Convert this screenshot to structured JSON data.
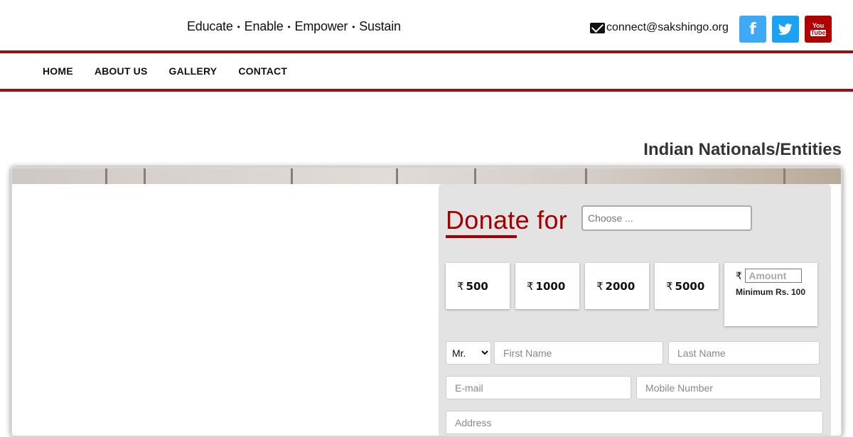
{
  "header": {
    "tagline": [
      "Educate",
      "Enable",
      "Empower",
      "Sustain"
    ],
    "tagline_separator": "•",
    "email": "connect@sakshingo.org",
    "social": {
      "facebook_glyph": "f",
      "youtube_glyph_top": "You",
      "youtube_glyph_bottom": "Tube"
    }
  },
  "nav": {
    "items": [
      "HOME",
      "ABOUT US",
      "GALLERY",
      "CONTACT"
    ]
  },
  "section_title": "Indian Nationals/Entities",
  "donate": {
    "title": "Donate for",
    "choose_placeholder": "Choose ...",
    "currency_symbol": "₹",
    "amounts": [
      "500",
      "1000",
      "2000",
      "5000"
    ],
    "custom_amount_placeholder": "Amount",
    "minimum_text": "Minimum Rs. 100",
    "salutation": "Mr.",
    "salutation_options": [
      "Mr."
    ],
    "first_name_placeholder": "First Name",
    "last_name_placeholder": "Last Name",
    "email_placeholder": "E-mail",
    "mobile_placeholder": "Mobile Number",
    "address_placeholder": "Address"
  },
  "colors": {
    "brand_red": "#9b0e0e",
    "donate_red": "#a00000",
    "facebook": "#3fa9f5",
    "twitter": "#1da1f2",
    "youtube": "#b00000"
  },
  "icons": [
    "envelope-icon",
    "facebook-icon",
    "twitter-icon",
    "youtube-icon"
  ]
}
